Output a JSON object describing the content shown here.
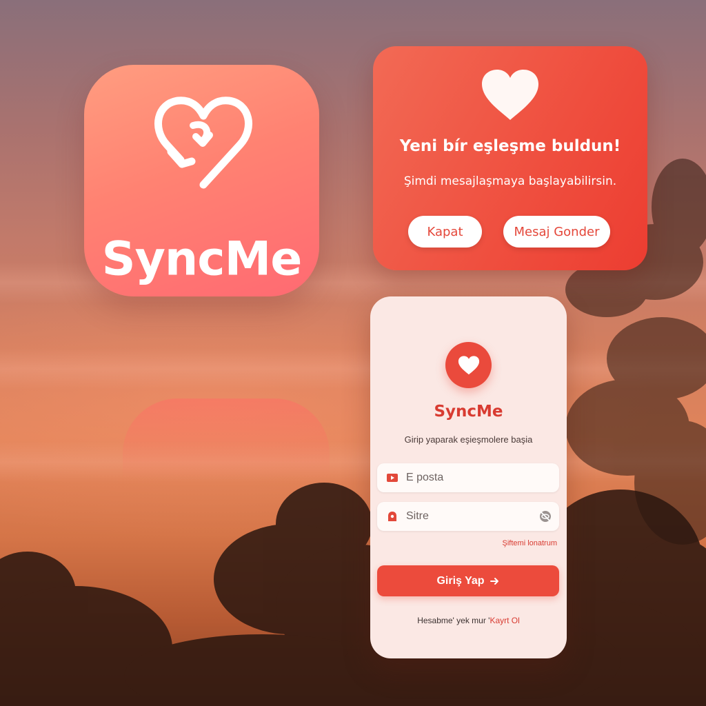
{
  "app_icon": {
    "name": "SyncMe",
    "logo_icon": "heart-sync-icon"
  },
  "match_card": {
    "icon": "heart-icon",
    "title": "Yeni bír eşleşme buldun!",
    "subtitle": "Şimdi mesajlaşmaya başlayabilirsin.",
    "close_label": "Kapat",
    "send_label": "Mesaj Gonder"
  },
  "login": {
    "logo_icon": "heart-icon",
    "brand": "SyncMe",
    "tagline": "Girip yaparak eşieşmolere başia",
    "email_placeholder": "E posta",
    "email_value": "",
    "email_icon": "email-icon",
    "password_placeholder": "Sitre",
    "password_value": "",
    "password_icon": "lock-icon",
    "password_toggle_icon": "eye-off-icon",
    "forgot_label": "Şiftemi lonatrum",
    "login_label": "Giriş Yap",
    "login_icon": "arrow-right-icon",
    "signup_prefix": "Hesabme' yek mur '",
    "signup_link": "Kayrt Ol"
  },
  "colors": {
    "accent": "#EC4B3C",
    "brand_red": "#D83B31",
    "icon_gradient_top": "#FF9D80",
    "icon_gradient_bottom": "#FF6A72",
    "card_background": "#FBE8E4"
  }
}
